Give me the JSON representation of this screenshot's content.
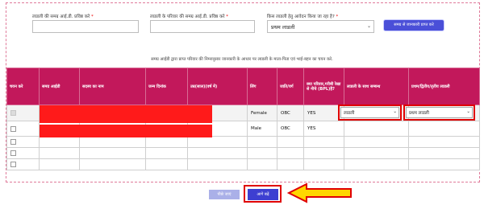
{
  "form": {
    "field1_label": "लाडली की समग्र आई.डी. प्रविष्ठ करे",
    "field2_label": "लाडली के परिवार की समग्र आई.डी. प्रविष्ठ करे",
    "field3_label": "किस लाडली हेतु आवेदन किया जा रहा है?",
    "required_mark": "*",
    "field3_value": "प्रथम लाडली",
    "fetch_button": "समग्र से जानकारी प्राप्त करे"
  },
  "caption": "समग्र आईडी द्वारा प्राप्त परिवार की निम्नानुसार जानकारी के आधार पर लाडली के माता-पिता एवं भाई-बहन का चयन करे.",
  "table": {
    "headers": [
      "चयन करे",
      "समग्र आईडी",
      "सदस्य का नाम",
      "जन्म दिनांक",
      "उम्र(साल)(वर्ष में)",
      "लिंग",
      "जाति/वर्ग",
      "क्या परिवार,गरीबी रेखा से नीचे (BPL)है?",
      "लाडली के साथ सम्बन्ध",
      "प्रथम/द्वितीय/तृतीय लाडली"
    ],
    "rows": [
      {
        "gender": "Female",
        "category": "OBC",
        "bpl": "YES",
        "relation": "लाडली",
        "ladli": "प्रथम लाडली"
      },
      {
        "gender": "Male",
        "category": "OBC",
        "bpl": "YES",
        "relation": "",
        "ladli": ""
      }
    ]
  },
  "buttons": {
    "back": "पीछे जाएं",
    "next": "आगे बढ़ें"
  },
  "colors": {
    "header_bg": "#c2185b",
    "highlight": "#e00000",
    "redaction": "#ff1a1a",
    "button_primary": "#3d3fd1",
    "arrow_fill": "#ffd600"
  }
}
